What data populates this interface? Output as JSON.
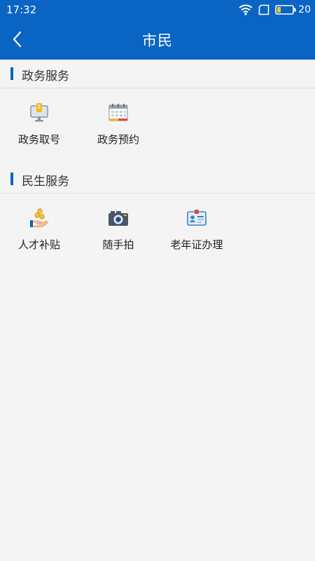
{
  "status_bar": {
    "time": "17:32",
    "battery": "20"
  },
  "app_bar": {
    "title": "市民"
  },
  "sections": [
    {
      "title": "政务服务",
      "items": [
        {
          "label": "政务取号",
          "icon": "queue-ticket-icon"
        },
        {
          "label": "政务预约",
          "icon": "calendar-icon"
        }
      ]
    },
    {
      "title": "民生服务",
      "items": [
        {
          "label": "人才补贴",
          "icon": "coins-hand-icon"
        },
        {
          "label": "随手拍",
          "icon": "camera-icon"
        },
        {
          "label": "老年证办理",
          "icon": "id-card-icon"
        }
      ]
    }
  ],
  "colors": {
    "brand": "#0a64c3",
    "background": "#f4f4f4"
  }
}
